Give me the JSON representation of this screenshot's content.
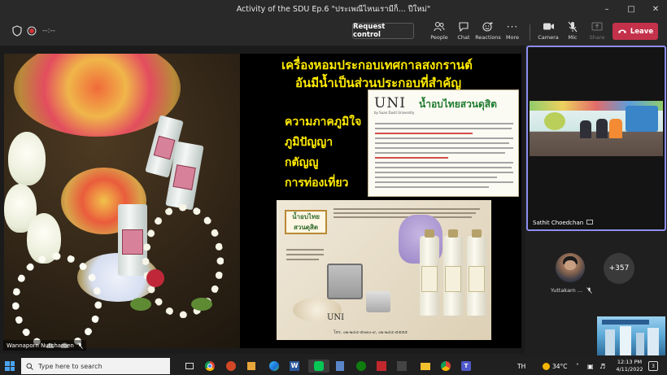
{
  "window": {
    "title": "Activity of the SDU Ep.6 \"ประเพณีไหนเรามีก็... ปีใหม่\"",
    "controls": [
      "minimize-icon",
      "maximize-icon",
      "close-icon"
    ]
  },
  "toolbar": {
    "timer": "--:--",
    "request_control": "Request control",
    "buttons": [
      {
        "id": "people",
        "label": "People",
        "icon": "people-icon"
      },
      {
        "id": "chat",
        "label": "Chat",
        "icon": "chat-icon"
      },
      {
        "id": "reactions",
        "label": "Reactions",
        "icon": "reactions-icon"
      },
      {
        "id": "more",
        "label": "More",
        "icon": "more-icon"
      },
      {
        "id": "camera",
        "label": "Camera",
        "icon": "camera-icon"
      },
      {
        "id": "mic",
        "label": "Mic",
        "icon": "mic-off-icon"
      },
      {
        "id": "share",
        "label": "Share",
        "icon": "share-icon"
      }
    ],
    "leave": "Leave"
  },
  "slide": {
    "heading_line1": "เครื่องหอมประกอบเทศกาลสงกรานต์",
    "heading_line2": "อันมีน้ำเป็นส่วนประกอบที่สำคัญ",
    "list": [
      "ความภาคภูมิใจ",
      "ภูมิปัญญา",
      "กตัญญู",
      "การท่องเที่ยว"
    ],
    "article": {
      "logo": "UNI",
      "logo_sub": "by Suan Dusit University",
      "title": "น้ำอบไทยสวนดุสิต"
    },
    "product": {
      "tag_line1": "น้ำอบไทย",
      "tag_line2": "สวนดุสิต",
      "logo": "UNI",
      "footer": "โทร. ๐๒-๒๔๔-๕๓๓๐-๙, ๐๒-๒๔๔-๕๕๕๕"
    }
  },
  "presenter": {
    "name": "Wannaporn Nutcharoen"
  },
  "participants": {
    "video_name": "Sathit Choedchan",
    "avatar_name": "Yuttakarn ...",
    "more_count": "+357"
  },
  "taskbar": {
    "search_placeholder": "Type here to search",
    "lang": "TH",
    "temp": "34°C",
    "time": "12:13 PM",
    "date": "4/11/2022",
    "notif_count": "3",
    "apps": [
      "task-view",
      "chrome",
      "powerpoint",
      "media-player",
      "edge",
      "word",
      "line",
      "calculator",
      "xbox",
      "app-red",
      "file-explorer",
      "chrome-2",
      "teams"
    ]
  }
}
